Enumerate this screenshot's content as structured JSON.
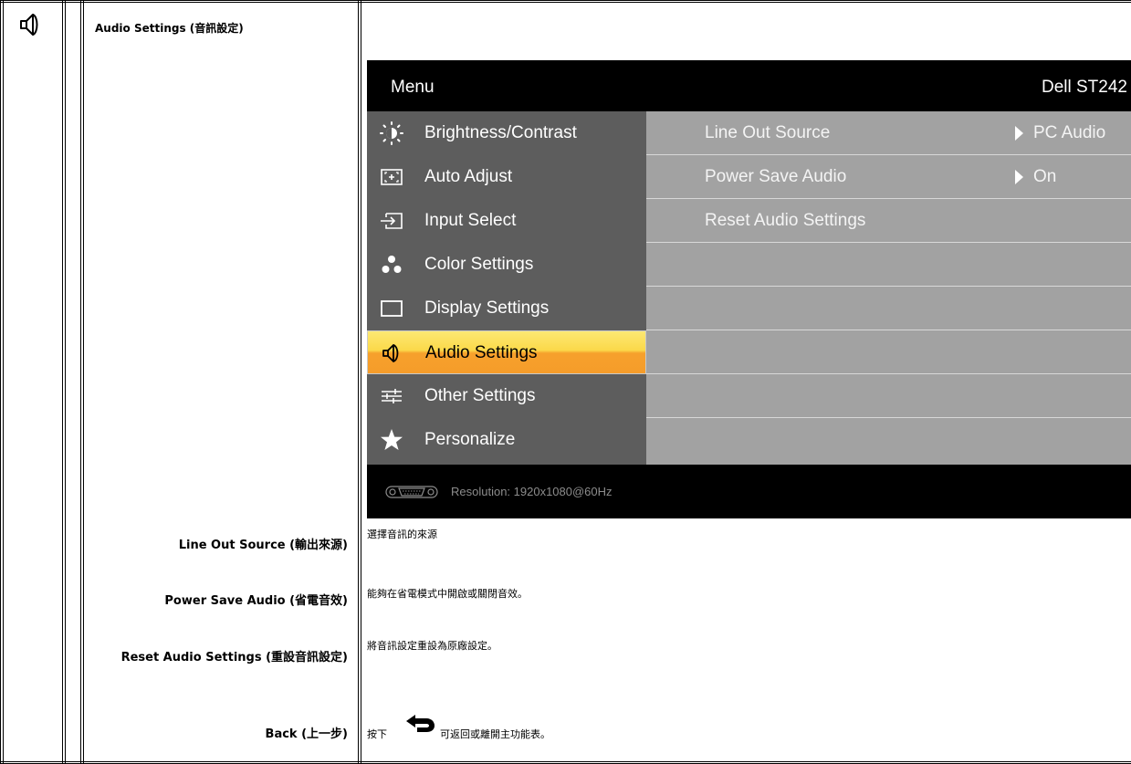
{
  "section": {
    "icon": "speaker-icon",
    "title": "Audio Settings (音訊設定)"
  },
  "osd": {
    "menu_title": "Menu",
    "model": "Dell ST242",
    "menu_items": [
      {
        "icon": "brightness-icon",
        "label": "Brightness/Contrast"
      },
      {
        "icon": "auto-adjust-icon",
        "label": "Auto Adjust"
      },
      {
        "icon": "input-select-icon",
        "label": "Input Select"
      },
      {
        "icon": "color-settings-icon",
        "label": "Color Settings"
      },
      {
        "icon": "display-settings-icon",
        "label": "Display Settings"
      },
      {
        "icon": "speaker-icon",
        "label": "Audio Settings",
        "selected": true
      },
      {
        "icon": "other-settings-icon",
        "label": "Other Settings"
      },
      {
        "icon": "star-icon",
        "label": "Personalize"
      }
    ],
    "options": [
      {
        "label": "Line Out Source",
        "value": "PC Audio"
      },
      {
        "label": "Power Save Audio",
        "value": "On"
      },
      {
        "label": "Reset Audio Settings",
        "value": ""
      },
      {
        "label": "",
        "value": ""
      },
      {
        "label": "",
        "value": ""
      },
      {
        "label": "",
        "value": ""
      },
      {
        "label": "",
        "value": ""
      },
      {
        "label": "",
        "value": ""
      }
    ],
    "resolution": "Resolution: 1920x1080@60Hz",
    "colors": {
      "menu_bg": "#5d5d5d",
      "options_bg": "#a2a2a2",
      "highlight_top": "#fce873",
      "highlight_bottom": "#f59c2a"
    }
  },
  "rows": [
    {
      "label": "Line Out Source (輸出來源)",
      "desc": "選擇音訊的來源"
    },
    {
      "label": "Power Save Audio (省電音效)",
      "desc": "能夠在省電模式中開啟或關閉音效。"
    },
    {
      "label": "Reset Audio Settings (重設音訊設定)",
      "desc": "將音訊設定重設為原廠設定。"
    },
    {
      "label": "Back (上一步)",
      "desc_before": "按下",
      "desc_icon": "back-arrow-icon",
      "desc_after": "可返回或離開主功能表。"
    }
  ]
}
